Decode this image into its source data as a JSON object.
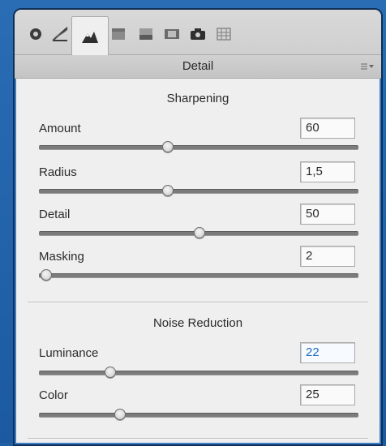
{
  "toolbar": {
    "tools": [
      {
        "name": "basic-icon"
      },
      {
        "name": "tone-curve-icon"
      },
      {
        "name": "detail-icon",
        "active": true
      },
      {
        "name": "hsl-icon"
      },
      {
        "name": "split-toning-icon"
      },
      {
        "name": "lens-corrections-icon"
      },
      {
        "name": "camera-calibration-icon"
      },
      {
        "name": "presets-icon"
      }
    ]
  },
  "panel": {
    "title": "Detail",
    "menu_icon": "panel-menu-icon"
  },
  "sharpening": {
    "title": "Sharpening",
    "controls": [
      {
        "label": "Amount",
        "value": "60",
        "min": 0,
        "max": 150,
        "level": 60
      },
      {
        "label": "Radius",
        "value": "1,5",
        "min": 0.5,
        "max": 3.0,
        "level": 1.5
      },
      {
        "label": "Detail",
        "value": "50",
        "min": 0,
        "max": 100,
        "level": 50
      },
      {
        "label": "Masking",
        "value": "2",
        "min": 0,
        "max": 100,
        "level": 2
      }
    ]
  },
  "noise_reduction": {
    "title": "Noise Reduction",
    "controls": [
      {
        "label": "Luminance",
        "value": "22",
        "min": 0,
        "max": 100,
        "level": 22,
        "highlight": true
      },
      {
        "label": "Color",
        "value": "25",
        "min": 0,
        "max": 100,
        "level": 25
      }
    ]
  },
  "colors": {
    "frame_blue": "#1f5fa2",
    "panel_bg": "#efefef",
    "highlight_value": "#1e6dbf"
  }
}
